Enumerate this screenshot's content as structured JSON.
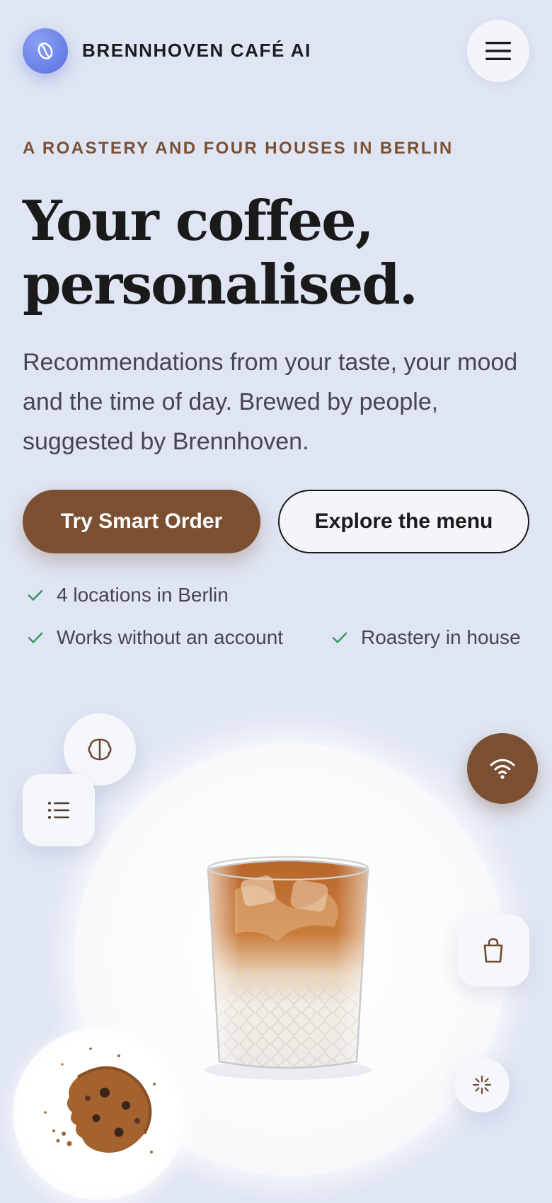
{
  "header": {
    "brand_name": "BRENNHOVEN CAFÉ AI",
    "logo_icon": "coffee-bean-icon",
    "menu_icon": "hamburger-menu-icon"
  },
  "hero": {
    "eyebrow": "A ROASTERY AND FOUR HOUSES IN BERLIN",
    "title_line1": "Your coffee,",
    "title_line2": "personalised.",
    "subtitle": "Recommendations from your taste, your mood and the time of day. Brewed by people, suggested by Brennhoven."
  },
  "actions": {
    "primary_label": "Try Smart Order",
    "secondary_label": "Explore the menu"
  },
  "features": [
    {
      "label": "4 locations in Berlin",
      "icon": "check-icon"
    },
    {
      "label": "Works without an account",
      "icon": "check-icon"
    },
    {
      "label": "Roastery in house",
      "icon": "check-icon"
    }
  ],
  "visual": {
    "product": "iced-latte-glass",
    "side_product": "chocolate-chip-cookie",
    "floating_icons": [
      "brain-icon",
      "list-icon",
      "wifi-icon",
      "shopping-bag-icon",
      "sparkle-icon"
    ]
  },
  "colors": {
    "background": "#dfe5f3",
    "accent_brown": "#7b4f32",
    "logo_blue": "#5a6fe0",
    "check_green": "#3a9a6a",
    "text_dark": "#1a1a1a",
    "text_muted": "#45464f"
  }
}
